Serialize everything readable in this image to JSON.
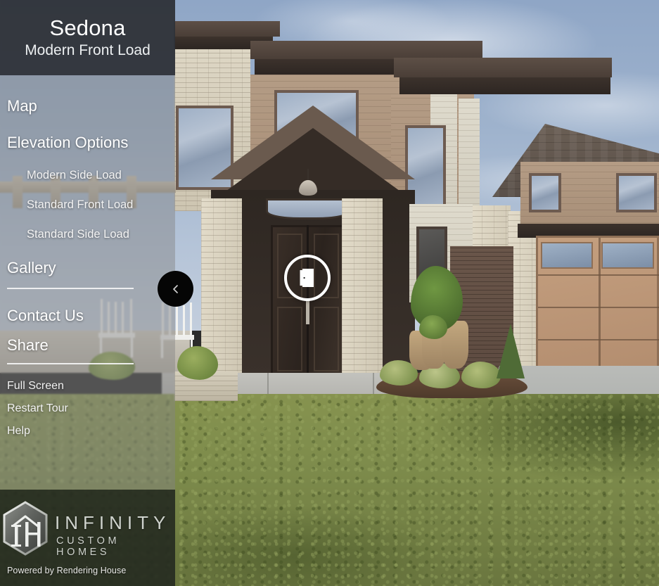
{
  "header": {
    "title": "Sedona",
    "subtitle": "Modern Front Load"
  },
  "menu": {
    "primary": [
      {
        "label": "Map",
        "name": "map"
      },
      {
        "label": "Elevation Options",
        "name": "elevation-options"
      }
    ],
    "elevation_options": [
      {
        "label": "Modern Side Load"
      },
      {
        "label": "Standard Front Load"
      },
      {
        "label": "Standard Side Load"
      }
    ],
    "gallery": {
      "label": "Gallery"
    },
    "group_two": [
      {
        "label": "Contact Us"
      },
      {
        "label": "Share"
      }
    ],
    "group_three": [
      {
        "label": "Full Screen"
      },
      {
        "label": "Restart Tour"
      },
      {
        "label": "Help"
      }
    ]
  },
  "controls": {
    "collapse_sidebar": "chevron-left-icon",
    "door_hotspot": "door-icon"
  },
  "footer": {
    "logo_monogram": "IH",
    "brand_name": "INFINITY",
    "brand_sub": "CUSTOM HOMES",
    "powered_by": "Powered by Rendering House"
  },
  "colors": {
    "sidebar_overlay": "#828282",
    "titlebar": "#24262c",
    "footer_overlay": "#181e14",
    "text": "#ffffff",
    "hotspot_ring": "#ffffff",
    "collapse_button": "#050505",
    "brand_text": "#cfd3cd",
    "sky": "#9fb3cd",
    "lawn": "#7e8c4c",
    "roof": "#4a3e37",
    "brick": "#ddd6c4",
    "garage_door": "#c49f7f"
  },
  "scene": {
    "description": "Exterior architectural rendering of a two-story modern prairie style home with front-load garage"
  }
}
